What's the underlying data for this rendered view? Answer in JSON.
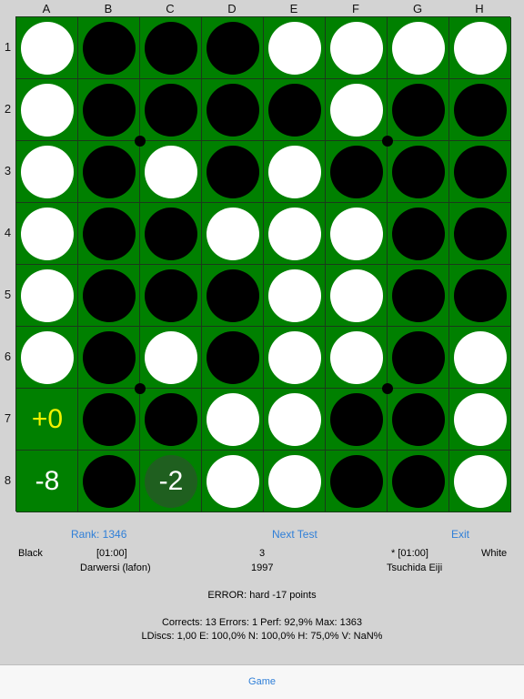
{
  "board": {
    "columns": [
      "A",
      "B",
      "C",
      "D",
      "E",
      "F",
      "G",
      "H"
    ],
    "rows": [
      "1",
      "2",
      "3",
      "4",
      "5",
      "6",
      "7",
      "8"
    ],
    "cells": [
      [
        "W",
        "B",
        "B",
        "B",
        "W",
        "W",
        "W",
        "W"
      ],
      [
        "W",
        "B",
        "B",
        "B",
        "B",
        "W",
        "B",
        "B"
      ],
      [
        "W",
        "B",
        "W",
        "B",
        "W",
        "B",
        "B",
        "B"
      ],
      [
        "W",
        "B",
        "B",
        "W",
        "W",
        "W",
        "B",
        "B"
      ],
      [
        "W",
        "B",
        "B",
        "B",
        "W",
        "W",
        "B",
        "B"
      ],
      [
        "W",
        "B",
        "W",
        "B",
        "W",
        "W",
        "B",
        "W"
      ],
      [
        "",
        "B",
        "B",
        "W",
        "W",
        "B",
        "B",
        "W"
      ],
      [
        "",
        "B",
        "",
        "W",
        "W",
        "B",
        "B",
        "W"
      ]
    ],
    "annotations": [
      {
        "row": 6,
        "col": 0,
        "text": "+0",
        "color": "#f2f200",
        "disc": false
      },
      {
        "row": 7,
        "col": 0,
        "text": "-8",
        "color": "#ffffff",
        "disc": false
      },
      {
        "row": 7,
        "col": 2,
        "text": "-2",
        "color": "#ffffff",
        "disc": true
      }
    ],
    "colors": {
      "board": "#008000",
      "black_disc": "#000000",
      "white_disc": "#ffffff",
      "hint_disc": "#1f5f1f",
      "best_move_text": "#f2f200"
    }
  },
  "actions": {
    "rank": "Rank: 1346",
    "next_test": "Next Test",
    "exit": "Exit"
  },
  "players": {
    "black_label": "Black",
    "black_time": "[01:00]",
    "black_name": "Darwersi (lafon)",
    "game_number": "3",
    "year": "1997",
    "white_time": "* [01:00]",
    "white_label": "White",
    "white_name": "Tsuchida Eiji"
  },
  "result": {
    "error": "ERROR:  hard  -17 points"
  },
  "stats": {
    "line1": "Corrects: 13  Errors: 1  Perf: 92,9%  Max: 1363",
    "line2": "LDiscs: 1,00  E: 100,0%  N: 100,0%  H: 75,0%  V: NaN%"
  },
  "tabbar": {
    "game": "Game"
  }
}
